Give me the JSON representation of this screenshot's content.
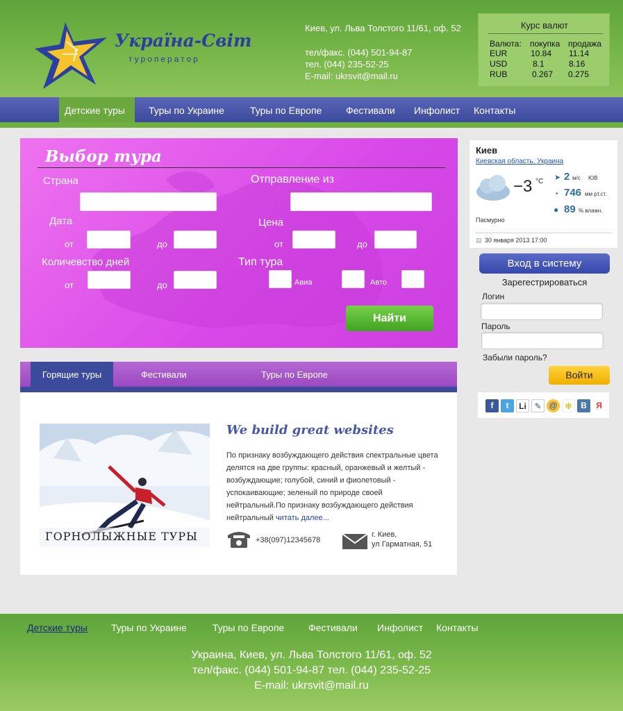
{
  "header": {
    "logo_title": "Україна-Світ",
    "logo_subtitle": "туроператор",
    "address": "Киев, ул. Льва Толстого 11/61, оф. 52",
    "phone1": "тел/факс. (044) 501-94-87",
    "phone2": "тел. (044) 235-52-25",
    "email": "E-mail: ukrsvit@mail.ru"
  },
  "currency": {
    "title": "Курс валют",
    "headers": [
      "Валюта:",
      "покупка",
      "продажа"
    ],
    "rows": [
      [
        "EUR",
        "10.84",
        "11.14"
      ],
      [
        "USD",
        "8.1",
        "8.16"
      ],
      [
        "RUB",
        "0.267",
        "0.275"
      ]
    ]
  },
  "nav": {
    "items": [
      "Детские туры",
      "Туры по Украине",
      "Туры по Европе",
      "Фестивали",
      "Инфолист",
      "Контакты"
    ]
  },
  "tour_search": {
    "title": "Выбор тура",
    "country_label": "Страна",
    "departure_label": "Отправление из",
    "date_label": "Дата",
    "price_label": "Цена",
    "days_label": "Количевство дней",
    "type_label": "Тип тура",
    "from": "от",
    "to": "до",
    "avia": "Авиа",
    "auto": "Авто",
    "find_button": "Найти"
  },
  "tabs": [
    "Горящие туры",
    "Фестивали",
    "Туры по Европе"
  ],
  "article": {
    "image_caption": "ГОРНОЛЫЖНЫЕ ТУРЫ",
    "title": "We build great websites",
    "body": "По признаку возбуждающего действия спектральные цвета делятся на две группы: красный, оранжевый и желтый - возбуждающие; голубой, синий и фиолетовый - успокаивающие; зеленый по природе своей нейтральный.По признаку возбуждающего действия нейтральный",
    "read_more": "читать далее...",
    "phone": "+38(097)12345678",
    "address_line1": "г. Киев,",
    "address_line2": "ул Гарматная, 51"
  },
  "weather": {
    "city": "Киев",
    "region": "Киевская область",
    "country": "Украина",
    "temp": "−3",
    "temp_unit": "°C",
    "wind_value": "2",
    "wind_unit": "м/с",
    "wind_dir": "ЮВ",
    "pressure_value": "746",
    "pressure_unit": "мм рт.ст.",
    "humidity_value": "89",
    "humidity_unit": "% влажн.",
    "description": "Пасмурно",
    "date": "30 января 2013 17:00"
  },
  "login": {
    "button": "Вход в систему",
    "register": "Зарегестрироваться",
    "login_label": "Логин",
    "password_label": "Пароль",
    "forgot": "Забыли пароль?",
    "enter": "Войти"
  },
  "social": [
    "facebook-icon",
    "twitter-icon",
    "linkedin-icon",
    "livejournal-icon",
    "mail-icon",
    "delicious-icon",
    "vkontakte-icon",
    "yandex-icon"
  ],
  "footer": {
    "nav": [
      "Детские туры",
      "Туры по Украине",
      "Туры по Европе",
      "Фестивали",
      "Инфолист",
      "Контакты"
    ],
    "address": "Украина, Киев, ул. Льва Толстого 11/61, оф. 52",
    "phones": "тел/факс. (044) 501-94-87 тел. (044) 235-52-25",
    "email": "E-mail: ukrsvit@mail.ru"
  },
  "colors": {
    "header_green": "#7ab84a",
    "nav_blue": "#3c4a9c",
    "tour_pink": "#d748e8",
    "accent_yellow": "#ffc61a"
  }
}
